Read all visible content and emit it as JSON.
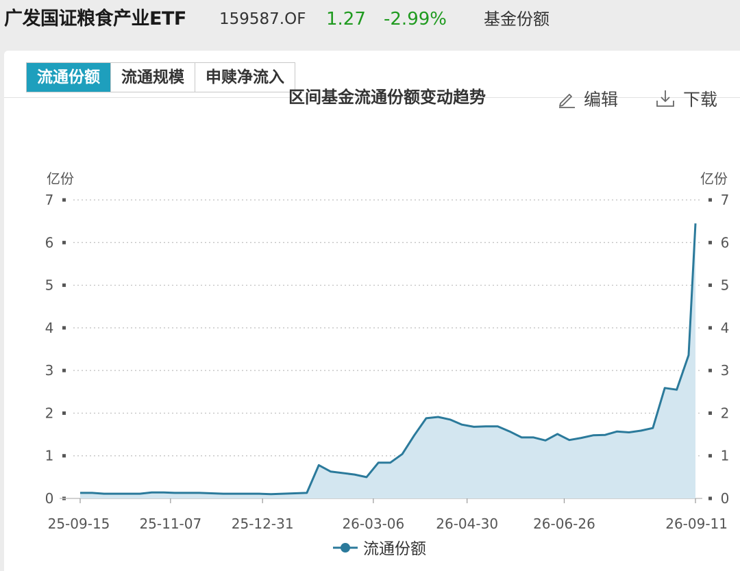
{
  "header": {
    "fund_name": "广发国证粮食产业ETF",
    "fund_code": "159587.OF",
    "price": "1.27",
    "change": "-2.99%",
    "metric": "基金份额"
  },
  "tabs": [
    {
      "label": "流通份额",
      "active": true
    },
    {
      "label": "流通规模",
      "active": false
    },
    {
      "label": "申赎净流入",
      "active": false
    }
  ],
  "toolbar": {
    "edit_label": "编辑",
    "edit_icon": "pencil-icon",
    "download_label": "下载",
    "download_icon": "download-icon"
  },
  "colors": {
    "accent": "#1e9fbd",
    "line": "#2b7a9b",
    "area": "#d3e6f0",
    "positive_change": "#1f9a1f"
  },
  "chart_data": {
    "type": "area",
    "title": "区间基金流通份额变动趋势",
    "ylabel_left": "亿份",
    "ylabel_right": "亿份",
    "ylim": [
      0,
      7
    ],
    "yticks": [
      "0",
      "1",
      "2",
      "3",
      "4",
      "5",
      "6",
      "7"
    ],
    "xticks": [
      "25-09-15",
      "25-11-07",
      "25-12-31",
      "26-03-06",
      "26-04-30",
      "26-06-26",
      "26-09-11"
    ],
    "grid": true,
    "legend": "bottom",
    "series": [
      {
        "name": "流通份额",
        "x": [
          "25-09-15",
          "25-09-22",
          "25-09-29",
          "25-10-13",
          "25-10-20",
          "25-10-27",
          "25-11-03",
          "25-11-10",
          "25-11-17",
          "25-11-24",
          "25-12-01",
          "25-12-08",
          "25-12-15",
          "25-12-22",
          "25-12-29",
          "26-01-05",
          "26-01-12",
          "26-01-19",
          "26-01-26",
          "26-02-02",
          "26-02-09",
          "26-02-23",
          "26-03-02",
          "26-03-09",
          "26-03-16",
          "26-03-23",
          "26-03-30",
          "26-04-06",
          "26-04-13",
          "26-04-20",
          "26-04-27",
          "26-05-04",
          "26-05-11",
          "26-05-18",
          "26-05-25",
          "26-06-01",
          "26-06-08",
          "26-06-15",
          "26-06-22",
          "26-06-29",
          "26-07-06",
          "26-07-13",
          "26-07-20",
          "26-07-27",
          "26-08-03",
          "26-08-10",
          "26-08-17",
          "26-08-24",
          "26-08-31",
          "26-09-07",
          "26-09-11"
        ],
        "values": [
          0.13,
          0.13,
          0.11,
          0.11,
          0.11,
          0.14,
          0.14,
          0.13,
          0.13,
          0.13,
          0.12,
          0.11,
          0.11,
          0.11,
          0.11,
          0.1,
          0.11,
          0.12,
          0.13,
          0.78,
          0.63,
          0.56,
          0.5,
          0.84,
          0.84,
          1.04,
          1.48,
          1.88,
          1.91,
          1.85,
          1.73,
          1.68,
          1.69,
          1.69,
          1.57,
          1.43,
          1.43,
          1.36,
          1.51,
          1.37,
          1.42,
          1.48,
          1.49,
          1.57,
          1.55,
          1.59,
          1.65,
          2.59,
          2.55,
          3.36,
          6.45
        ]
      }
    ]
  }
}
